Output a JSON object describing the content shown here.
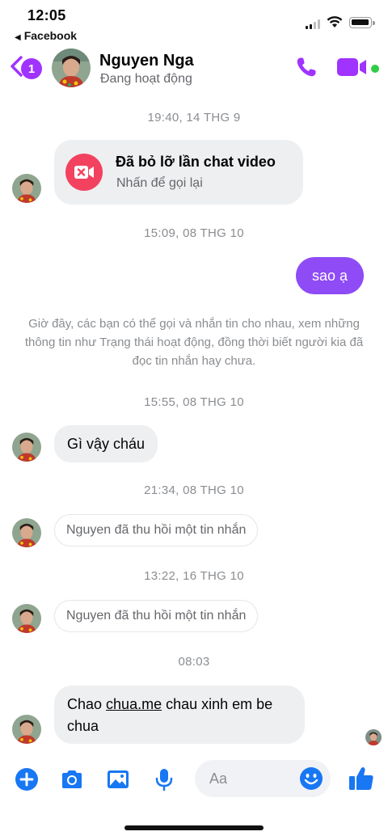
{
  "status_bar": {
    "time": "12:05",
    "back_app": "Facebook",
    "signal_bars_active": 2,
    "battery_level": 0.85
  },
  "header": {
    "unread_count": "1",
    "contact_name": "Nguyen Nga",
    "contact_status": "Đang hoạt động",
    "accent_color": "#a033ff",
    "online_color": "#31cc46",
    "icons": [
      "back-chevron-icon",
      "phone-icon",
      "video-camera-icon"
    ]
  },
  "messages": [
    {
      "type": "timestamp",
      "text": "19:40, 14 THG 9"
    },
    {
      "type": "missed_call",
      "title": "Đã bỏ lỡ lần chat video",
      "subtitle": "Nhấn để gọi lại",
      "icon": "missed-video-call-icon",
      "icon_color": "#f3425f"
    },
    {
      "type": "timestamp",
      "text": "15:09, 08 THG 10"
    },
    {
      "type": "outgoing",
      "text": "sao ạ",
      "color": "#8e4bf6"
    },
    {
      "type": "info",
      "text": "Giờ đây, các bạn có thể gọi và nhắn tin cho nhau, xem những thông tin như Trạng thái hoạt động, đồng thời biết người kia đã đọc tin nhắn hay chưa."
    },
    {
      "type": "timestamp",
      "text": "15:55, 08 THG 10"
    },
    {
      "type": "incoming",
      "text": "Gì vậy cháu"
    },
    {
      "type": "timestamp",
      "text": "21:34, 08 THG 10"
    },
    {
      "type": "unsent",
      "text": "Nguyen đã thu hồi một tin nhắn"
    },
    {
      "type": "timestamp",
      "text": "13:22, 16 THG 10"
    },
    {
      "type": "unsent",
      "text": "Nguyen đã thu hồi một tin nhắn"
    },
    {
      "type": "timestamp",
      "text": "08:03"
    },
    {
      "type": "incoming",
      "text_before": "Chao ",
      "link": "chua.me",
      "text_after": " chau xinh em be chua"
    }
  ],
  "composer": {
    "placeholder": "Aa",
    "icons": [
      "plus-icon",
      "camera-icon",
      "image-icon",
      "microphone-icon",
      "emoji-icon",
      "thumbs-up-icon"
    ],
    "icon_color": "#1877f2"
  }
}
